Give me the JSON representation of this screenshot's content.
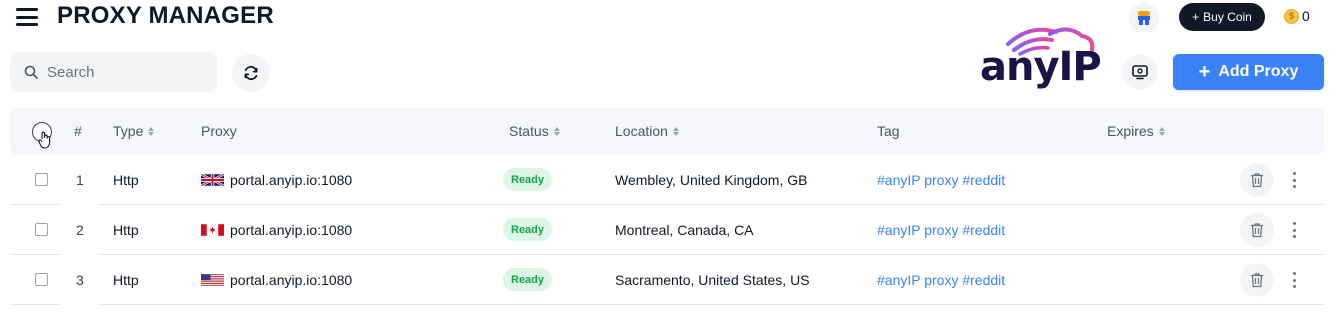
{
  "header": {
    "title": "PROXY MANAGER",
    "buy_coin_label": "Buy Coin",
    "coin_count": "0",
    "add_proxy_label": "Add Proxy",
    "logo_text": "anyIP"
  },
  "search": {
    "placeholder": "Search",
    "value": ""
  },
  "table": {
    "columns": [
      "#",
      "Type",
      "Proxy",
      "Status",
      "Location",
      "Tag",
      "Expires"
    ],
    "sortable": [
      "Type",
      "Status",
      "Location",
      "Expires"
    ],
    "rows": [
      {
        "num": "1",
        "type": "Http",
        "flag": "gb-flag",
        "proxy": "portal.anyip.io:1080",
        "status": "Ready",
        "location": "Wembley, United Kingdom, GB",
        "tag": "#anyIP proxy #reddit"
      },
      {
        "num": "2",
        "type": "Http",
        "flag": "ca-flag",
        "proxy": "portal.anyip.io:1080",
        "status": "Ready",
        "location": "Montreal, Canada, CA",
        "tag": "#anyIP proxy #reddit"
      },
      {
        "num": "3",
        "type": "Http",
        "flag": "us-flag",
        "proxy": "portal.anyip.io:1080",
        "status": "Ready",
        "location": "Sacramento, United States, US",
        "tag": "#anyIP proxy #reddit"
      }
    ]
  },
  "icons": [
    "menu-icon",
    "search-icon",
    "refresh-icon",
    "avatar-icon",
    "plus-icon",
    "coin-icon",
    "screen-icon",
    "trash-icon",
    "more-vertical-icon",
    "hand-cursor-icon"
  ],
  "colors": {
    "accent": "#3b82f6",
    "status_bg": "#dcf5e7",
    "status_text": "#16a34a",
    "tag_text": "#3b82f6",
    "buy_coin_bg": "#111827",
    "logo_dark": "#1a1446",
    "logo_gradient_start": "#8b5cf6",
    "logo_gradient_end": "#ec4899"
  }
}
